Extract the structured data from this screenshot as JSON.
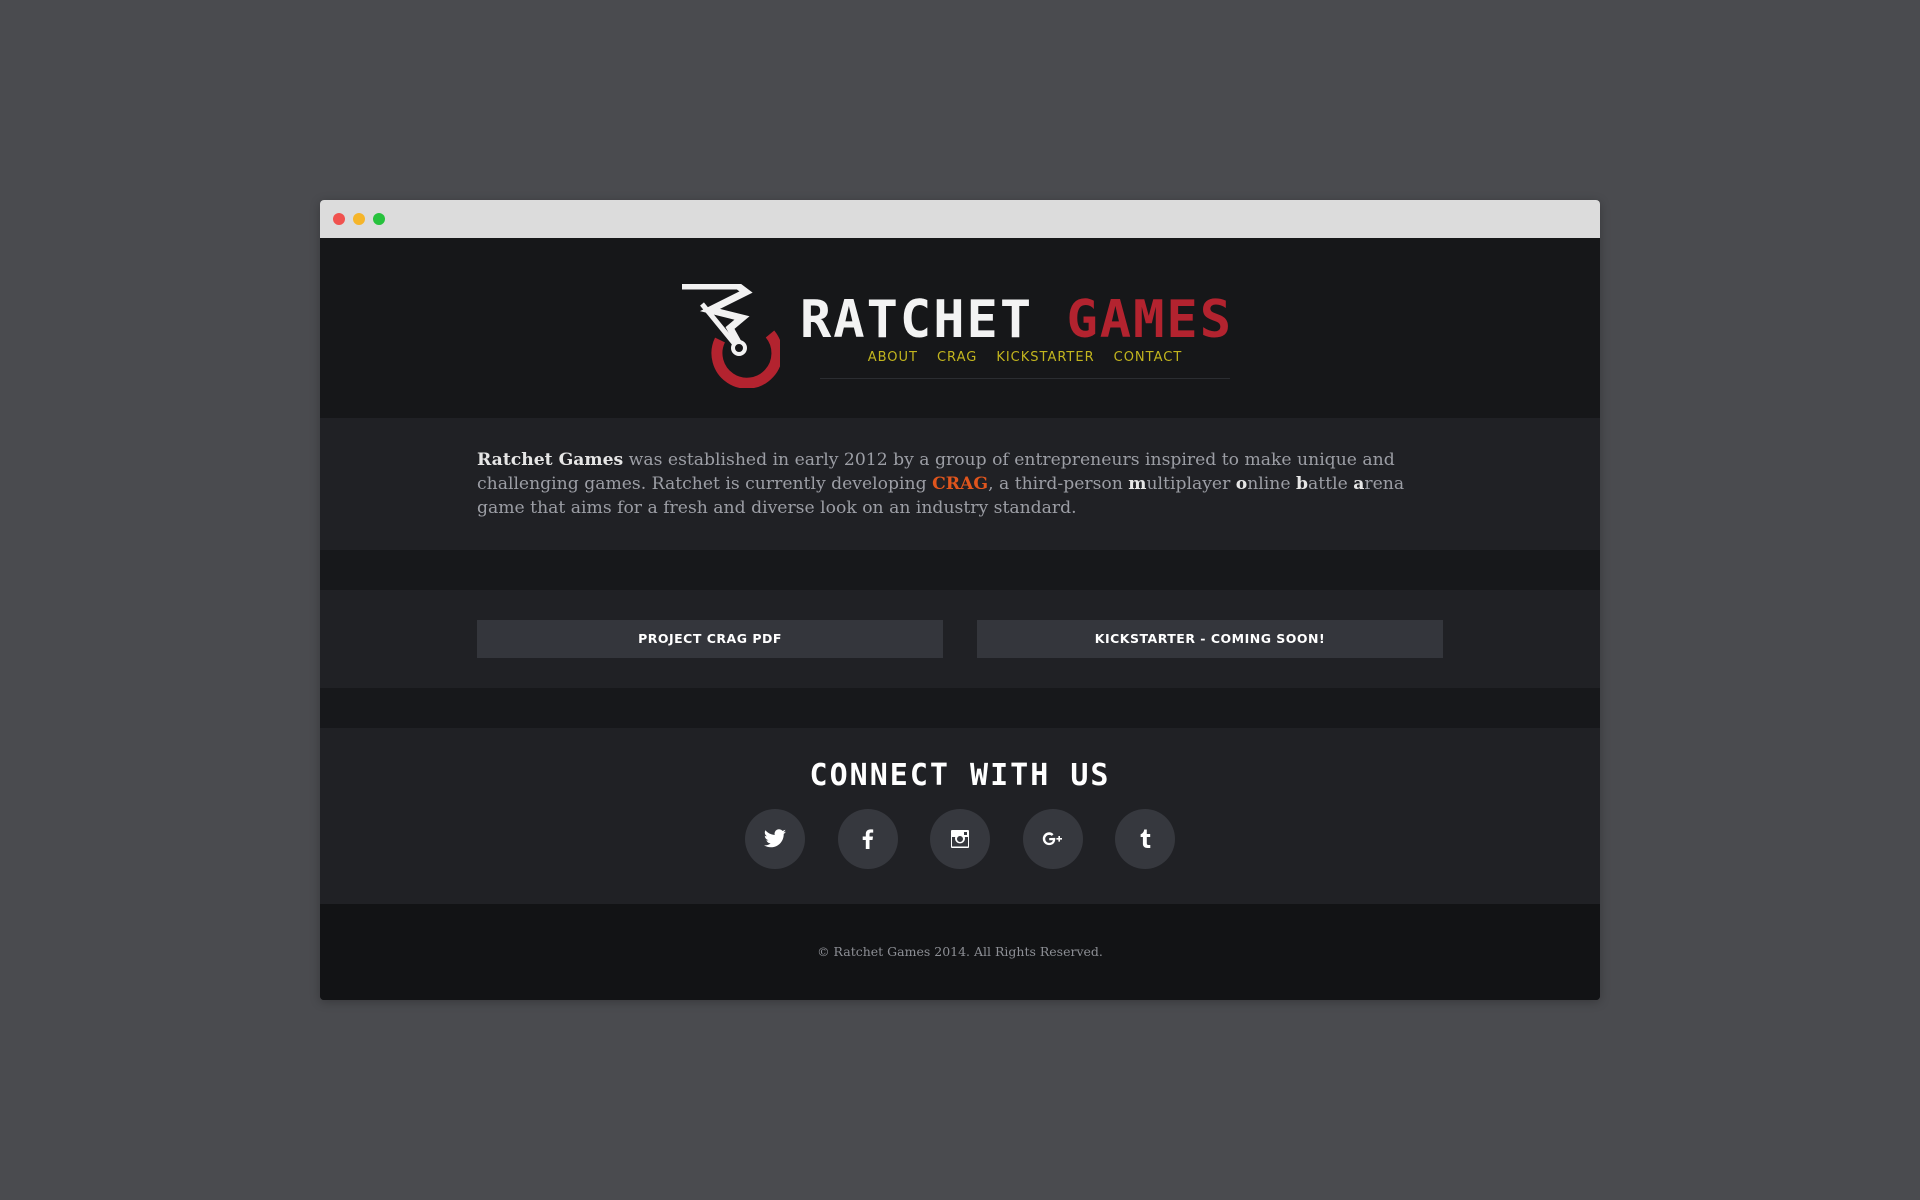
{
  "brand": {
    "word1": "RATCHET",
    "word2": "GAMES",
    "colors": {
      "white": "#f3f3f3",
      "red": "#b3232f"
    }
  },
  "nav": {
    "items": [
      "ABOUT",
      "CRAG",
      "KICKSTARTER",
      "CONTACT"
    ],
    "color": "#c2b51e"
  },
  "about": {
    "company": "Ratchet Games",
    "text1": " was established in early 2012 by a group of entrepreneurs inspired to make unique and challenging games. Ratchet is currently developing ",
    "game": "CRAG",
    "text2": ", a third-person ",
    "m": "m",
    "m_rest": "ultiplayer ",
    "o": "o",
    "o_rest": "nline ",
    "b": "b",
    "b_rest": "attle ",
    "a": "a",
    "a_rest": "rena game that aims for a fresh and diverse look on an industry standard.",
    "accent": "#e0551d"
  },
  "buttons": {
    "pdf": "PROJECT CRAG PDF",
    "kickstarter": "KICKSTARTER - COMING SOON!"
  },
  "connect": {
    "title": "CONNECT WITH US",
    "icons": [
      "twitter-icon",
      "facebook-icon",
      "instagram-icon",
      "google-plus-icon",
      "tumblr-icon"
    ]
  },
  "footer": {
    "copyright": "© Ratchet Games 2014. All Rights Reserved."
  }
}
